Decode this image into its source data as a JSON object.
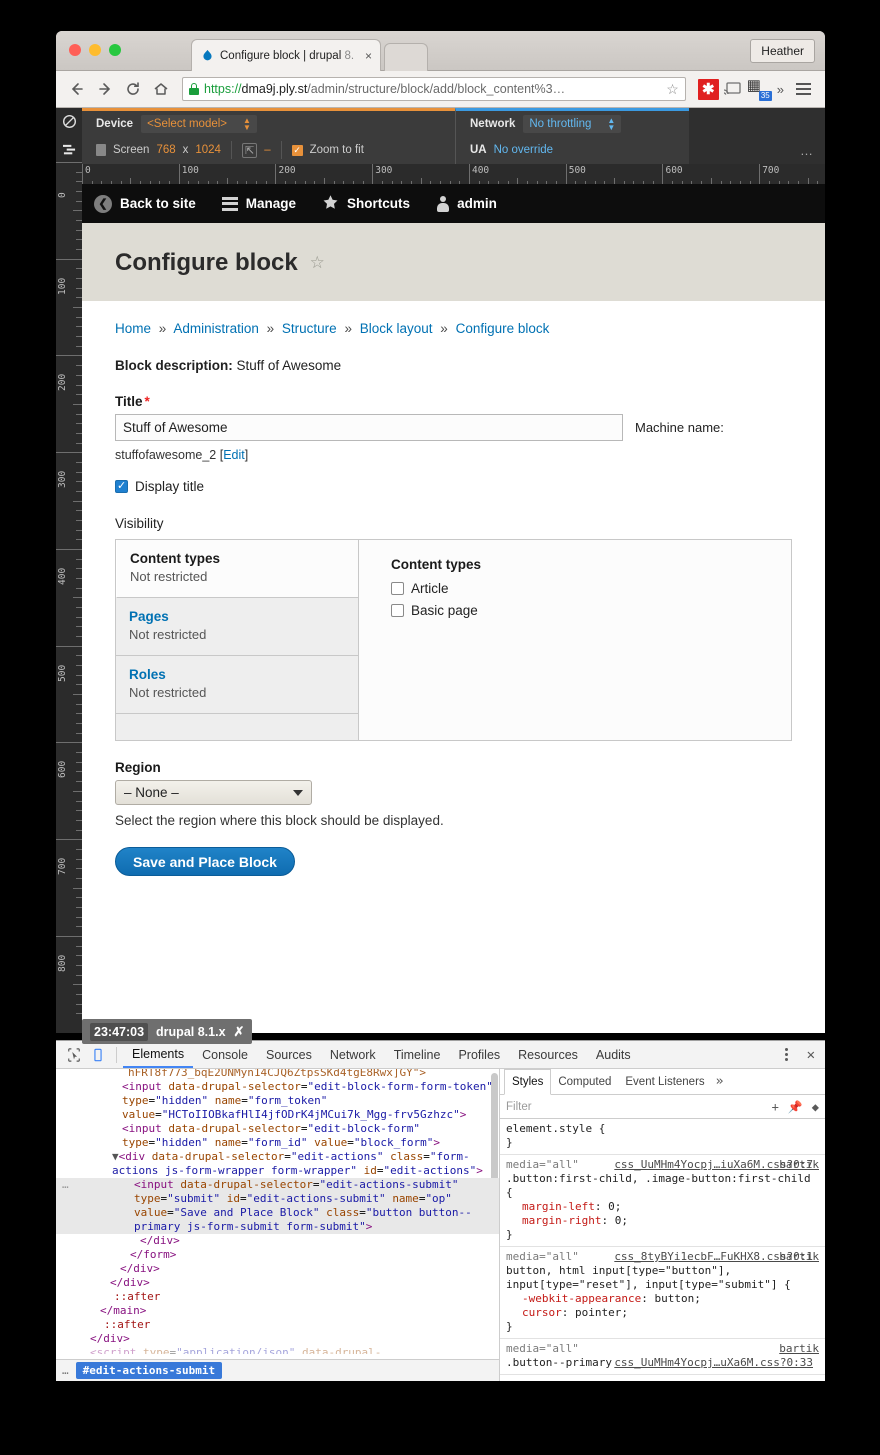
{
  "browser": {
    "tab_title_main": "Configure block | drupal ",
    "tab_title_dim": "8.",
    "tab_close": "×",
    "profile_name": "Heather",
    "url_scheme": "https://",
    "url_host": "dma9j.ply.st",
    "url_path": "/admin/structure/block/add/block_content%3…",
    "ext_badge_count": "35",
    "overflow_chevron": "»"
  },
  "device_toolbar": {
    "device_label": "Device",
    "device_model": "<Select model>",
    "screen_label": "Screen",
    "screen_w": "768",
    "screen_x": "x",
    "screen_h": "1024",
    "scale_dash": "–",
    "zoom_to_fit": "Zoom to fit",
    "network_label": "Network",
    "network_value": "No throttling",
    "ua_label": "UA",
    "ua_value": "No override",
    "ellipsis": "…"
  },
  "ruler": {
    "h_labels": [
      "0",
      "100",
      "200",
      "300",
      "400",
      "500",
      "600",
      "700"
    ],
    "v_labels": [
      "0",
      "100",
      "200",
      "300",
      "400",
      "500",
      "600",
      "700",
      "800"
    ]
  },
  "admin_toolbar": {
    "items": [
      {
        "label": "Back to site",
        "icon": "chevron-left-circle-icon"
      },
      {
        "label": "Manage",
        "icon": "hamburger-icon"
      },
      {
        "label": "Shortcuts",
        "icon": "star-icon"
      },
      {
        "label": "admin",
        "icon": "user-icon"
      }
    ]
  },
  "page": {
    "title": "Configure block",
    "star": "☆",
    "breadcrumb": [
      "Home",
      "Administration",
      "Structure",
      "Block layout",
      "Configure block"
    ],
    "breadcrumb_sep": "»",
    "block_description_label": "Block description:",
    "block_description_value": "Stuff of Awesome",
    "title_label": "Title",
    "title_required": "*",
    "title_value": "Stuff of Awesome",
    "title_placeholder": "",
    "machine_name_label": "Machine name:",
    "machine_name_value": "stuffofawesome_2",
    "machine_name_edit_open": "[",
    "machine_name_edit": "Edit",
    "machine_name_edit_close": "]",
    "display_title_label": "Display title",
    "display_title_checked": true,
    "visibility_label": "Visibility",
    "visibility_tabs": [
      {
        "title": "Content types",
        "summary": "Not restricted",
        "active": true
      },
      {
        "title": "Pages",
        "summary": "Not restricted",
        "active": false
      },
      {
        "title": "Roles",
        "summary": "Not restricted",
        "active": false
      }
    ],
    "visibility_panel_heading": "Content types",
    "visibility_options": [
      {
        "label": "Article",
        "checked": false
      },
      {
        "label": "Basic page",
        "checked": false
      }
    ],
    "region_label": "Region",
    "region_value": "– None –",
    "region_description": "Select the region where this block should be displayed.",
    "save_button": "Save and Place Block"
  },
  "drupal_badge": {
    "time": "23:47:03",
    "label": "drupal 8.1.x",
    "close": "✗"
  },
  "devtools": {
    "tabs": [
      "Elements",
      "Console",
      "Sources",
      "Network",
      "Timeline",
      "Profiles",
      "Resources",
      "Audits"
    ],
    "selected_tab": "Elements",
    "inspect_icon": "cursor-select-icon",
    "device_icon": "device-toggle-icon",
    "close_icon": "✕",
    "elements_code": [
      "hFRT8f773_bqE2UNMyn14CJQ6ZtpsSKd4tgE8Rwx]GY\">",
      "<input data-drupal-selector=\"edit-block-form-form-token\" type=\"hidden\" name=\"form_token\" value=\"HCToIIOBkafHlI4jfODrK4jMCui7k_Mgg-frv5Gzhzc\">",
      "<input data-drupal-selector=\"edit-block-form\" type=\"hidden\" name=\"form_id\" value=\"block_form\">",
      "▼<div data-drupal-selector=\"edit-actions\" class=\"form-actions js-form-wrapper form-wrapper\" id=\"edit-actions\">",
      "<input data-drupal-selector=\"edit-actions-submit\" type=\"submit\" id=\"edit-actions-submit\" name=\"op\" value=\"Save and Place Block\" class=\"button button--primary js-form-submit form-submit\">",
      "</div>",
      "</form>",
      "</div>",
      "</div>",
      "::after",
      "</main>",
      "::after",
      "</div>"
    ],
    "breadcrumb_dots": "…",
    "breadcrumb_selected": "#edit-actions-submit",
    "styles_tabs": [
      "Styles",
      "Computed",
      "Event Listeners"
    ],
    "styles_more": "»",
    "filter_placeholder": "Filter",
    "styles_rules": [
      {
        "media": "",
        "source": "",
        "selector": "element.style {",
        "props": [],
        "close": "}"
      },
      {
        "media": "media=\"all\"",
        "source_name": "bartik",
        "source": "css_UuMHm4Yocpj…iuXa6M.css?0:7",
        "selector": ".button:first-child, .image-button:first-child {",
        "props": [
          {
            "name": "margin-left",
            "value": "0;"
          },
          {
            "name": "margin-right",
            "value": "0;"
          }
        ],
        "close": "}"
      },
      {
        "media": "media=\"all\"",
        "source_name": "bartik",
        "source": "css_8tyBYi1ecbF…FuKHX8.css?0:1",
        "selector": "button, html input[type=\"button\"], input[type=\"reset\"], input[type=\"submit\"] {",
        "props": [
          {
            "name": "-webkit-appearance",
            "value": "button;"
          },
          {
            "name": "cursor",
            "value": "pointer;"
          }
        ],
        "close": "}"
      },
      {
        "media": "media=\"all\"",
        "source_name": "bartik",
        "source": "css_UuMHm4Yocpj…uXa6M.css?0:33",
        "selector": ".button--primary",
        "props": [],
        "close": ""
      }
    ]
  }
}
